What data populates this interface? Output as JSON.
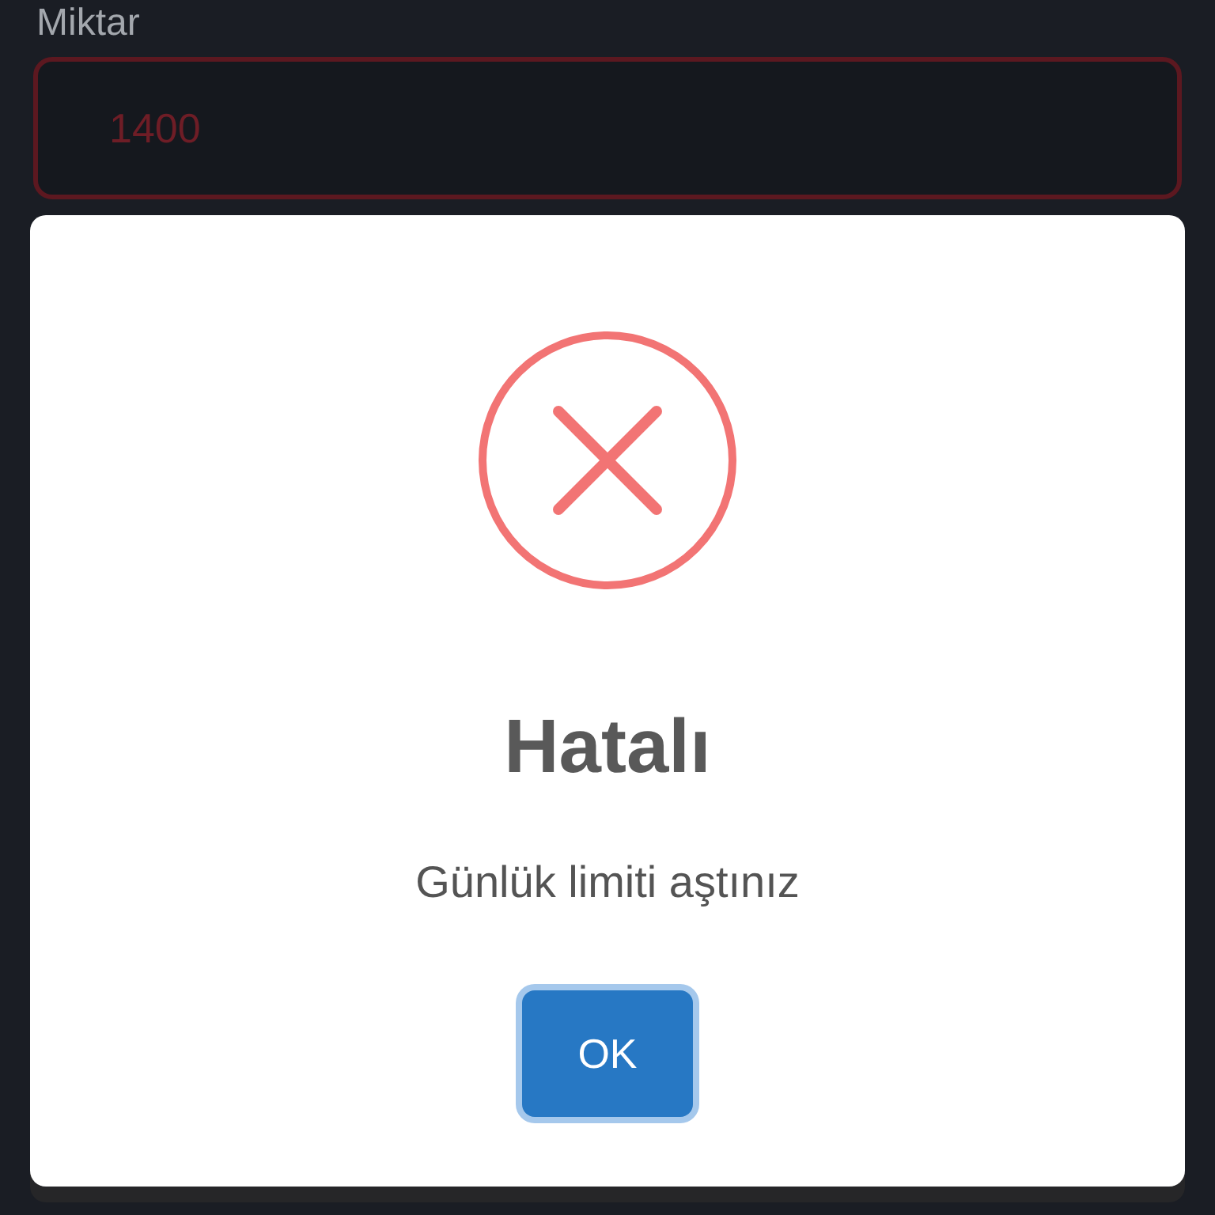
{
  "form": {
    "field": {
      "label": "Miktar",
      "value": "1400",
      "invalid": true
    }
  },
  "dialog": {
    "icon": {
      "kind": "error"
    },
    "title": "Hatalı",
    "message": "Günlük limiti aştınız",
    "buttons": [
      {
        "label": "OK",
        "focused": true
      }
    ]
  }
}
